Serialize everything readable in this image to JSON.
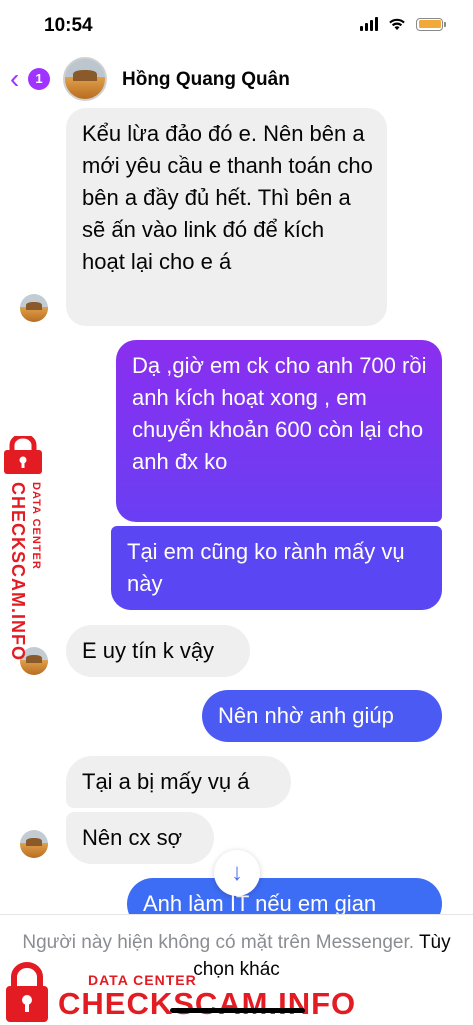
{
  "status_bar": {
    "time": "10:54"
  },
  "header": {
    "back_badge": "1",
    "contact_name": "Hồng Quang Quân"
  },
  "messages": [
    {
      "side": "in",
      "text": "Kểu lừa đảo đó e. Nên bên a mới yêu cầu e thanh toán cho bên a đầy đủ hết. Thì bên a sẽ ấn vào link đó để kích hoạt lại cho e á"
    },
    {
      "side": "out",
      "text": "Dạ ,giờ em ck cho anh 700 rồi anh kích hoạt xong , em chuyển khoản 600 còn lại cho anh đx ko"
    },
    {
      "side": "out",
      "text": "Tại em cũng ko rành mấy vụ này"
    },
    {
      "side": "in",
      "text": "E uy tín k vậy"
    },
    {
      "side": "out",
      "text": "Nên nhờ anh giúp"
    },
    {
      "side": "in",
      "text": "Tại a bị mấy vụ á"
    },
    {
      "side": "in",
      "text": "Nên cx sợ"
    },
    {
      "side": "out",
      "text": "Anh làm IT nếu em gian"
    }
  ],
  "footer": {
    "notice": "Người này hiện không có mặt trên Messenger.",
    "link": "Tùy chọn khác"
  },
  "watermark": {
    "small": "DATA CENTER",
    "big": "CHECKSCAM.INFO"
  },
  "colors": {
    "accent": "#a033ff",
    "bubble_in": "#efefef",
    "watermark": "#e31b23"
  }
}
